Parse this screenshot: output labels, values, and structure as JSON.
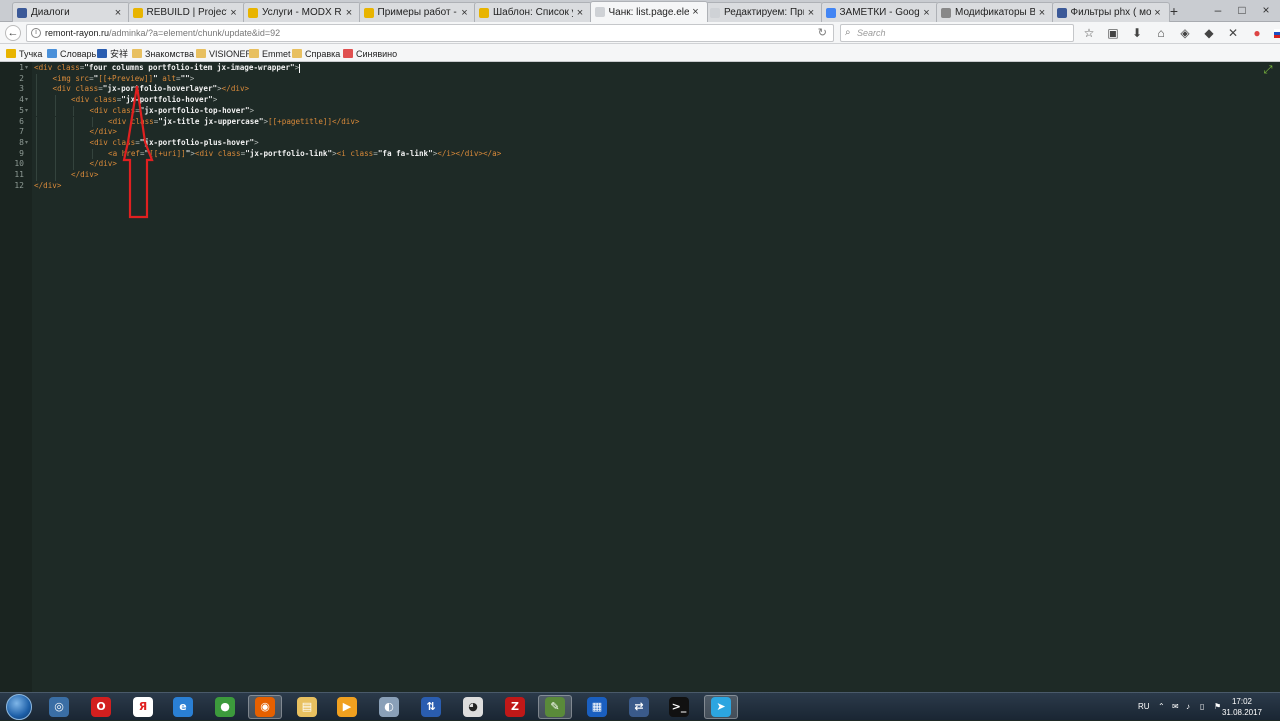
{
  "tabs": [
    {
      "label": "Диалоги",
      "color": "#3b5998",
      "active": false
    },
    {
      "label": "REBUILD | Projects",
      "color": "#e8b400",
      "active": false
    },
    {
      "label": "Услуги - MODX Revo",
      "color": "#e8b400",
      "active": false
    },
    {
      "label": "Примеры работ - M",
      "color": "#e8b400",
      "active": false
    },
    {
      "label": "Шаблон: Список услуг |",
      "color": "#e8b400",
      "active": false
    },
    {
      "label": "Чанк: list.page.element |",
      "color": "#cfd2d6",
      "active": true
    },
    {
      "label": "Редактируем: Примеры",
      "color": "#cfd2d6",
      "active": false
    },
    {
      "label": "ЗАМЕТКИ - Google D",
      "color": "#4285f4",
      "active": false
    },
    {
      "label": "Модификаторы Выв",
      "color": "#888888",
      "active": false
    },
    {
      "label": "Фильтры phx ( модис",
      "color": "#3b5998",
      "active": false
    }
  ],
  "tab_close_glyph": "×",
  "new_tab_glyph": "+",
  "window_controls": [
    "–",
    "□",
    "×"
  ],
  "address": {
    "host": "remont-rayon.ru",
    "path": "/adminka/?a=element/chunk/update&id=92",
    "reload_glyph": "↻"
  },
  "search": {
    "placeholder": "Search"
  },
  "nav_icons": [
    "star-icon",
    "clipboard-icon",
    "download-icon",
    "home-icon",
    "pocket-icon",
    "sync-icon",
    "close-icon",
    "chrome-icon",
    "flag-ru-icon",
    "menu-icon"
  ],
  "bookmarks": [
    {
      "label": "Тучка",
      "color": "#e8b400"
    },
    {
      "label": "Словарь",
      "color": "#4a90d9"
    },
    {
      "label": "安祥",
      "color": "#2a5db0"
    },
    {
      "label": "Знакомства",
      "color": "#e8c060"
    },
    {
      "label": "VISIONER",
      "color": "#e8c060"
    },
    {
      "label": "Emmet",
      "color": "#e8c060"
    },
    {
      "label": "Справка",
      "color": "#e8c060"
    },
    {
      "label": "Синявино",
      "color": "#e05050"
    }
  ],
  "editor": {
    "line_numbers": [
      "1",
      "2",
      "3",
      "4",
      "5",
      "6",
      "7",
      "8",
      "9",
      "10",
      "11",
      "12"
    ],
    "lines": [
      {
        "indent": 0,
        "tokens": [
          [
            "tag",
            "<div "
          ],
          [
            "attr",
            "class"
          ],
          [
            "punct",
            "="
          ],
          [
            "str",
            "\"four columns portfolio-item jx-image-wrapper\""
          ],
          [
            "punct",
            ">"
          ]
        ],
        "cursor": true
      },
      {
        "indent": 1,
        "tokens": [
          [
            "tag",
            "<img "
          ],
          [
            "attr",
            "src"
          ],
          [
            "punct",
            "="
          ],
          [
            "str",
            "\""
          ],
          [
            "ph",
            "[[+Preview]]"
          ],
          [
            "str",
            "\""
          ],
          [
            "plain",
            " "
          ],
          [
            "attr",
            "alt"
          ],
          [
            "punct",
            "="
          ],
          [
            "str",
            "\"\""
          ],
          [
            "punct",
            ">"
          ]
        ]
      },
      {
        "indent": 1,
        "tokens": [
          [
            "tag",
            "<div "
          ],
          [
            "attr",
            "class"
          ],
          [
            "punct",
            "="
          ],
          [
            "str",
            "\"jx-portfolio-hoverlayer\""
          ],
          [
            "punct",
            ">"
          ],
          [
            "tag",
            "</div>"
          ]
        ]
      },
      {
        "indent": 2,
        "tokens": [
          [
            "tag",
            "<div "
          ],
          [
            "attr",
            "class"
          ],
          [
            "punct",
            "="
          ],
          [
            "str",
            "\"jx-portfolio-hover\""
          ],
          [
            "punct",
            ">"
          ]
        ]
      },
      {
        "indent": 3,
        "tokens": [
          [
            "tag",
            "<div "
          ],
          [
            "attr",
            "class"
          ],
          [
            "punct",
            "="
          ],
          [
            "str",
            "\"jx-portfolio-top-hover\""
          ],
          [
            "punct",
            ">"
          ]
        ]
      },
      {
        "indent": 4,
        "tokens": [
          [
            "tag",
            "<div "
          ],
          [
            "attr",
            "class"
          ],
          [
            "punct",
            "="
          ],
          [
            "str",
            "\"jx-title jx-uppercase\""
          ],
          [
            "punct",
            ">"
          ],
          [
            "ph",
            "[[+pagetitle]]"
          ],
          [
            "tag",
            "</div>"
          ]
        ]
      },
      {
        "indent": 3,
        "tokens": [
          [
            "tag",
            "</div>"
          ]
        ]
      },
      {
        "indent": 3,
        "tokens": [
          [
            "tag",
            "<div "
          ],
          [
            "attr",
            "class"
          ],
          [
            "punct",
            "="
          ],
          [
            "str",
            "\"jx-portfolio-plus-hover\""
          ],
          [
            "punct",
            ">"
          ]
        ]
      },
      {
        "indent": 4,
        "tokens": [
          [
            "tag",
            "<a "
          ],
          [
            "attr",
            "href"
          ],
          [
            "punct",
            "="
          ],
          [
            "str",
            "\""
          ],
          [
            "ph",
            "[[+uri]]"
          ],
          [
            "str",
            "\""
          ],
          [
            "punct",
            ">"
          ],
          [
            "tag",
            "<div "
          ],
          [
            "attr",
            "class"
          ],
          [
            "punct",
            "="
          ],
          [
            "str",
            "\"jx-portfolio-link\""
          ],
          [
            "punct",
            ">"
          ],
          [
            "tag",
            "<i "
          ],
          [
            "attr",
            "class"
          ],
          [
            "punct",
            "="
          ],
          [
            "str",
            "\"fa fa-link\""
          ],
          [
            "punct",
            ">"
          ],
          [
            "tag",
            "</i></div></a>"
          ]
        ]
      },
      {
        "indent": 3,
        "tokens": [
          [
            "tag",
            "</div>"
          ]
        ]
      },
      {
        "indent": 2,
        "tokens": [
          [
            "tag",
            "</div>"
          ]
        ]
      },
      {
        "indent": 0,
        "tokens": [
          [
            "tag",
            "</div>"
          ]
        ]
      }
    ],
    "annotation_color": "#e02020",
    "expand_glyph": "⤢"
  },
  "taskbar": {
    "apps": [
      {
        "name": "browser-globe-icon",
        "glyph": "◎",
        "bg": "#3a6ea5",
        "active": false
      },
      {
        "name": "opera-icon",
        "glyph": "O",
        "bg": "#d21f1f",
        "active": false
      },
      {
        "name": "yandex-icon",
        "glyph": "Я",
        "bg": "#ffffff",
        "fg": "#e02020",
        "active": false
      },
      {
        "name": "ie-icon",
        "glyph": "e",
        "bg": "#2a7fd4",
        "active": false
      },
      {
        "name": "chrome-icon",
        "glyph": "●",
        "bg": "#3c9a3c",
        "active": false
      },
      {
        "name": "firefox-icon",
        "glyph": "◉",
        "bg": "#e66000",
        "active": true
      },
      {
        "name": "explorer-folder-icon",
        "glyph": "▤",
        "bg": "#e8c060",
        "active": false
      },
      {
        "name": "media-player-icon",
        "glyph": "▶",
        "bg": "#f0a020",
        "active": false
      },
      {
        "name": "disc-icon",
        "glyph": "◐",
        "bg": "#8aa0b8",
        "active": false
      },
      {
        "name": "network-icon",
        "glyph": "⇅",
        "bg": "#2a5db0",
        "active": false
      },
      {
        "name": "github-icon",
        "glyph": "◕",
        "bg": "#dddddd",
        "fg": "#222",
        "active": false
      },
      {
        "name": "filezilla-icon",
        "glyph": "Z",
        "bg": "#c01818",
        "active": false
      },
      {
        "name": "notepad-icon",
        "glyph": "✎",
        "bg": "#5a8a3a",
        "active": true
      },
      {
        "name": "grid-app-icon",
        "glyph": "▦",
        "bg": "#1a5fc0",
        "active": false
      },
      {
        "name": "transfer-icon",
        "glyph": "⇄",
        "bg": "#3a5a8a",
        "active": false
      },
      {
        "name": "terminal-icon",
        "glyph": ">_",
        "bg": "#111111",
        "active": false
      },
      {
        "name": "telegram-icon",
        "glyph": "➤",
        "bg": "#2ca5e0",
        "active": true
      }
    ],
    "lang": "RU",
    "tray_icons": [
      "⌃",
      "✉",
      "♪",
      "▯",
      "⚑"
    ],
    "time": "17:02",
    "date": "31.08.2017"
  }
}
